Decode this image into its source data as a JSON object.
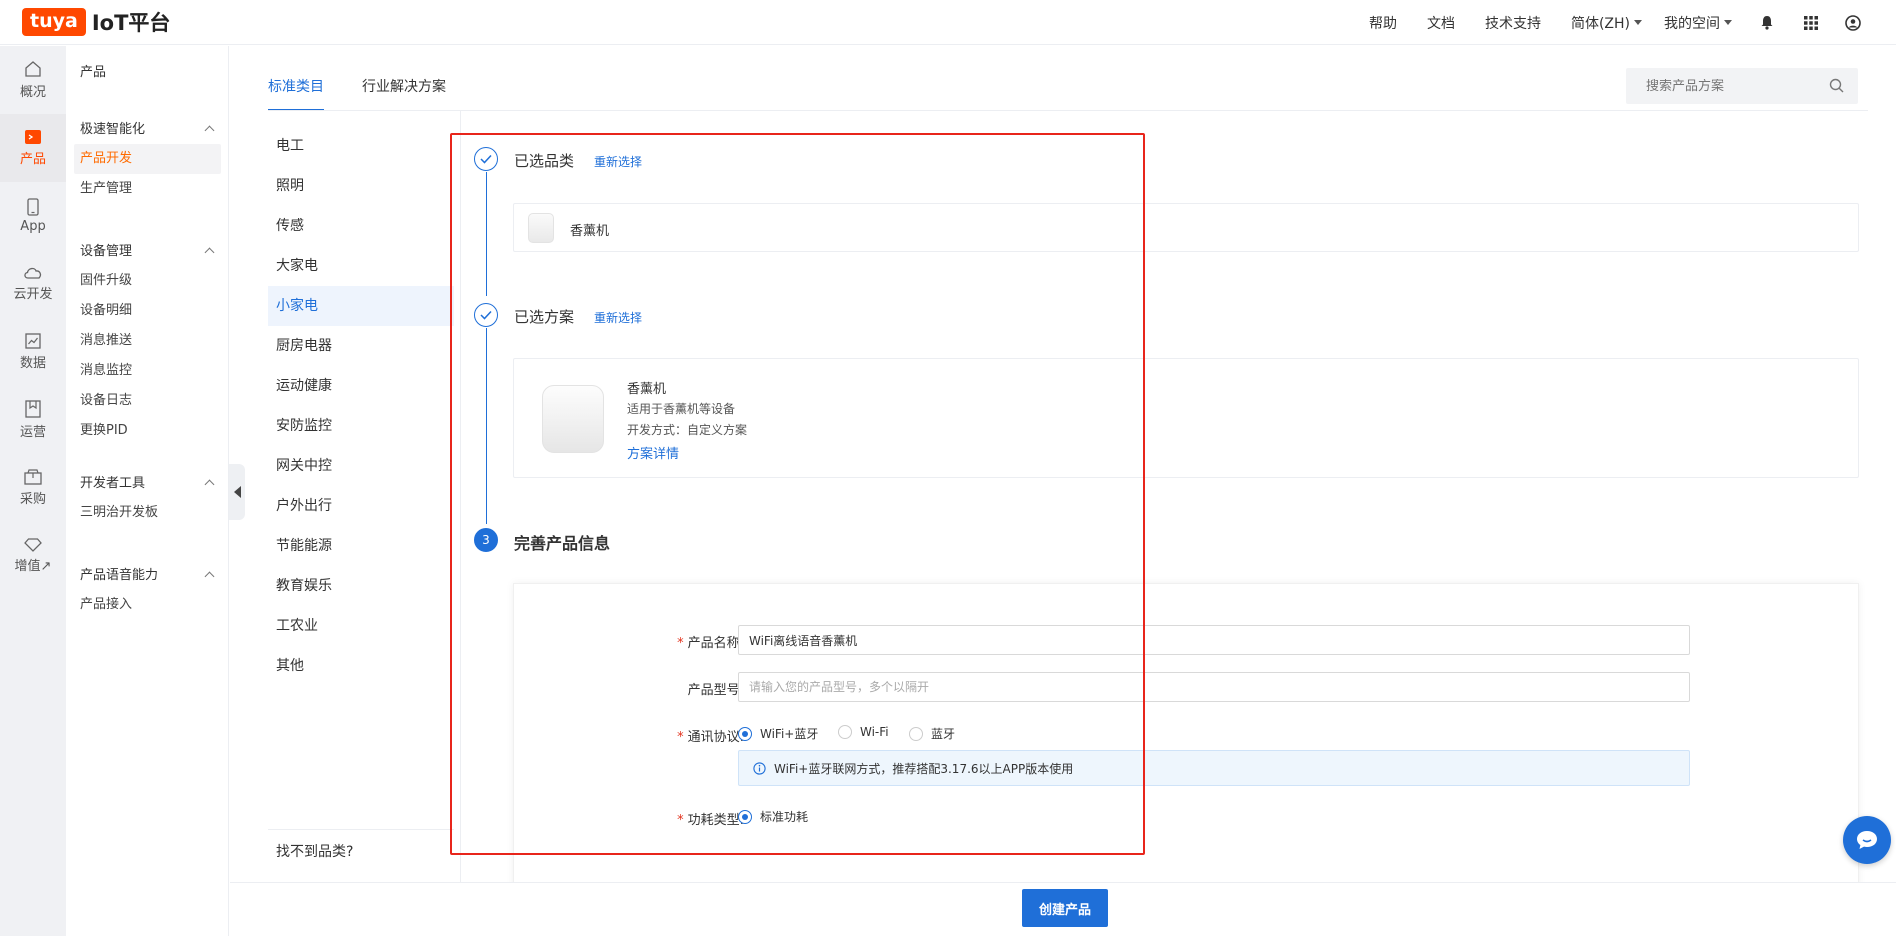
{
  "header": {
    "logo_badge": "tuya",
    "logo_text": "IoT平台",
    "nav": [
      "帮助",
      "文档",
      "技术支持"
    ],
    "language": "简体(ZH)",
    "space": "我的空间"
  },
  "rail": [
    {
      "label": "概况",
      "icon": "home-icon"
    },
    {
      "label": "产品",
      "icon": "product-icon",
      "active": true
    },
    {
      "label": "App",
      "icon": "phone-icon"
    },
    {
      "label": "云开发",
      "icon": "cloud-icon"
    },
    {
      "label": "数据",
      "icon": "chart-icon"
    },
    {
      "label": "运营",
      "icon": "bookmark-icon"
    },
    {
      "label": "采购",
      "icon": "box-icon"
    },
    {
      "label": "增值↗",
      "icon": "diamond-icon"
    }
  ],
  "sidebar": {
    "title": "产品",
    "groups": [
      {
        "title": "极速智能化",
        "items": [
          "产品开发",
          "生产管理"
        ]
      },
      {
        "title": "设备管理",
        "items": [
          "固件升级",
          "设备明细",
          "消息推送",
          "消息监控",
          "设备日志",
          "更换PID"
        ]
      },
      {
        "title": "开发者工具",
        "items": [
          "三明治开发板"
        ]
      },
      {
        "title": "产品语音能力",
        "items": [
          "产品接入"
        ]
      }
    ]
  },
  "tabs": [
    "标准类目",
    "行业解决方案"
  ],
  "search": {
    "placeholder": "搜索产品方案"
  },
  "categories": [
    "电工",
    "照明",
    "传感",
    "大家电",
    "小家电",
    "厨房电器",
    "运动健康",
    "安防监控",
    "网关中控",
    "户外出行",
    "节能能源",
    "教育娱乐",
    "工农业",
    "其他"
  ],
  "category_not_found": "找不到品类?",
  "steps": {
    "step1": {
      "title": "已选品类",
      "reselect": "重新选择",
      "selected_name": "香薰机"
    },
    "step2": {
      "title": "已选方案",
      "reselect": "重新选择",
      "name": "香薰机",
      "desc": "适用于香薰机等设备",
      "dev_mode": "开发方式：自定义方案",
      "detail_link": "方案详情"
    },
    "step3": {
      "number": "3",
      "title": "完善产品信息"
    }
  },
  "form": {
    "product_name": {
      "label": "产品名称:",
      "value": "WiFi离线语音香薰机"
    },
    "product_model": {
      "label": "产品型号:",
      "placeholder": "请输入您的产品型号，多个以隔开"
    },
    "protocol": {
      "label": "通讯协议:",
      "options": [
        "WiFi+蓝牙",
        "Wi-Fi",
        "蓝牙"
      ],
      "selected": "WiFi+蓝牙",
      "info": "WiFi+蓝牙联网方式，推荐搭配3.17.6以上APP版本使用"
    },
    "power": {
      "label": "功耗类型:",
      "options": [
        "标准功耗"
      ],
      "selected": "标准功耗"
    }
  },
  "create_button": "创建产品",
  "colors": {
    "brand": "#ff4800",
    "accent": "#1f6fd8",
    "highlight": "#e8251b"
  }
}
